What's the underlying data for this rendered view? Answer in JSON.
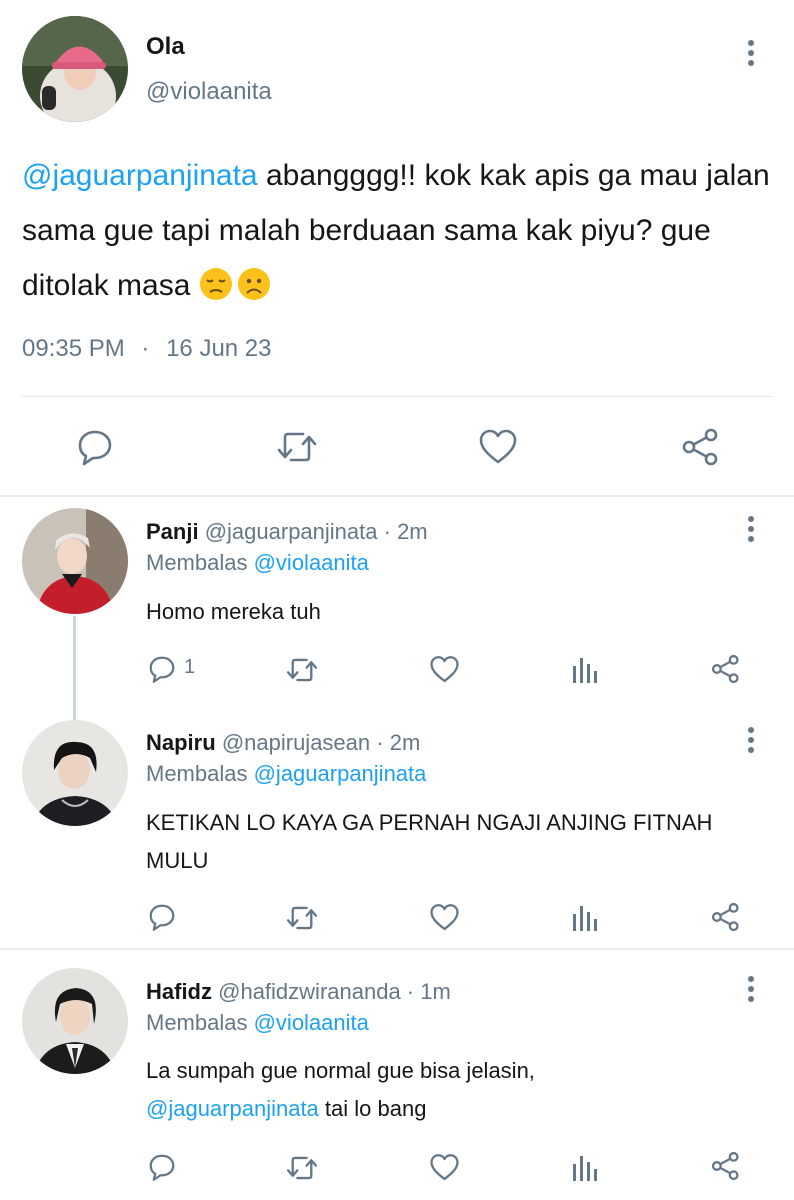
{
  "main_tweet": {
    "name": "Ola",
    "handle": "@violaanita",
    "mention": "@jaguarpanjinata",
    "text": " abangggg!! kok kak apis ga mau jalan sama gue tapi malah berduaan sama kak piyu? gue ditolak masa ",
    "emojis": [
      "pensive-face",
      "frowning-face"
    ],
    "time": "09:35 PM",
    "dot": "·",
    "date": "16 Jun 23"
  },
  "replies": [
    {
      "name": "Panji",
      "handle": "@jaguarpanjinata",
      "sep": " · ",
      "time": "2m",
      "replying_label": "Membalas ",
      "replying_to": "@violaanita",
      "text": "Homo mereka tuh",
      "reply_count": "1"
    },
    {
      "name": "Napiru",
      "handle": "@napirujasean",
      "sep": " · ",
      "time": "2m",
      "replying_label": "Membalas ",
      "replying_to": "@jaguarpanjinata",
      "text": "KETIKAN LO KAYA GA PERNAH NGAJI ANJING FITNAH MULU",
      "reply_count": ""
    },
    {
      "name": "Hafidz",
      "handle": "@hafidzwirananda",
      "sep": " · ",
      "time": "1m",
      "replying_label": "Membalas ",
      "replying_to": "@violaanita",
      "text_part1": "La sumpah gue normal gue bisa jelasin,",
      "text_mention": "@jaguarpanjinata",
      "text_part2": " tai lo bang",
      "reply_count": ""
    }
  ],
  "icons": {
    "reply": "speech-bubble-icon",
    "retweet": "retweet-icon",
    "like": "heart-icon",
    "views": "bar-chart-icon",
    "share": "share-icon",
    "more": "more-vertical-icon"
  },
  "colors": {
    "link": "#1da1f2",
    "muted": "#657786",
    "text": "#14171a",
    "divider": "#e1e8ed"
  }
}
